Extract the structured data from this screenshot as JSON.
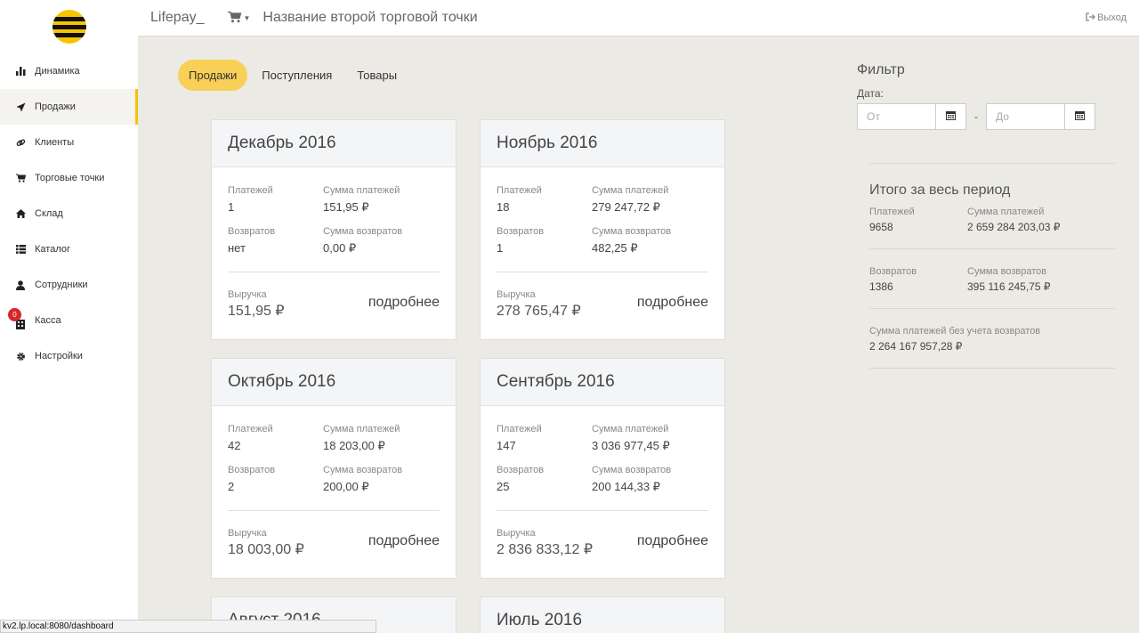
{
  "app": {
    "brand": "Lifepay_",
    "shop_name": "Название второй торговой точки",
    "logout": "Выход"
  },
  "colors": {
    "accent": "#f8cf57",
    "badge": "#d7262a",
    "background": "#eceae4"
  },
  "sidebar": {
    "items": [
      {
        "label": "Динамика",
        "icon": "bar-chart-icon"
      },
      {
        "label": "Продажи",
        "icon": "send-arrow-icon",
        "active": true
      },
      {
        "label": "Клиенты",
        "icon": "link-icon"
      },
      {
        "label": "Торговые точки",
        "icon": "cart-icon"
      },
      {
        "label": "Склад",
        "icon": "home-icon"
      },
      {
        "label": "Каталог",
        "icon": "list-icon"
      },
      {
        "label": "Сотрудники",
        "icon": "user-icon"
      },
      {
        "label": "Касса",
        "icon": "calculator-icon",
        "badge": "0"
      },
      {
        "label": "Настройки",
        "icon": "gear-icon"
      }
    ]
  },
  "tabs": [
    {
      "label": "Продажи",
      "active": true
    },
    {
      "label": "Поступления"
    },
    {
      "label": "Товары"
    }
  ],
  "labels": {
    "payments": "Платежей",
    "payments_sum": "Сумма платежей",
    "returns": "Возвратов",
    "returns_sum": "Сумма возвратов",
    "revenue": "Выручка",
    "more": "подробнее"
  },
  "cards": [
    {
      "title": "Декабрь 2016",
      "payments": "1",
      "payments_sum": "151,95 ₽",
      "returns": "нет",
      "returns_sum": "0,00 ₽",
      "revenue": "151,95 ₽"
    },
    {
      "title": "Ноябрь 2016",
      "payments": "18",
      "payments_sum": "279 247,72 ₽",
      "returns": "1",
      "returns_sum": "482,25 ₽",
      "revenue": "278 765,47 ₽"
    },
    {
      "title": "Октябрь 2016",
      "payments": "42",
      "payments_sum": "18 203,00 ₽",
      "returns": "2",
      "returns_sum": "200,00 ₽",
      "revenue": "18 003,00 ₽"
    },
    {
      "title": "Сентябрь 2016",
      "payments": "147",
      "payments_sum": "3 036 977,45 ₽",
      "returns": "25",
      "returns_sum": "200 144,33 ₽",
      "revenue": "2 836 833,12 ₽"
    },
    {
      "title": "Август 2016"
    },
    {
      "title": "Июль 2016"
    }
  ],
  "filter": {
    "title": "Фильтр",
    "date_label": "Дата:",
    "from_placeholder": "От",
    "to_placeholder": "До",
    "separator": "-"
  },
  "totals": {
    "title": "Итого за весь период",
    "payments_label": "Платежей",
    "payments": "9658",
    "payments_sum_label": "Сумма платежей",
    "payments_sum": "2 659 284 203,03 ₽",
    "returns_label": "Возвратов",
    "returns": "1386",
    "returns_sum_label": "Сумма возвратов",
    "returns_sum": "395 116 245,75 ₽",
    "net_label": "Сумма платежей без учета возвратов",
    "net": "2 264 167 957,28 ₽"
  },
  "status_bar": "kv2.lp.local:8080/dashboard"
}
